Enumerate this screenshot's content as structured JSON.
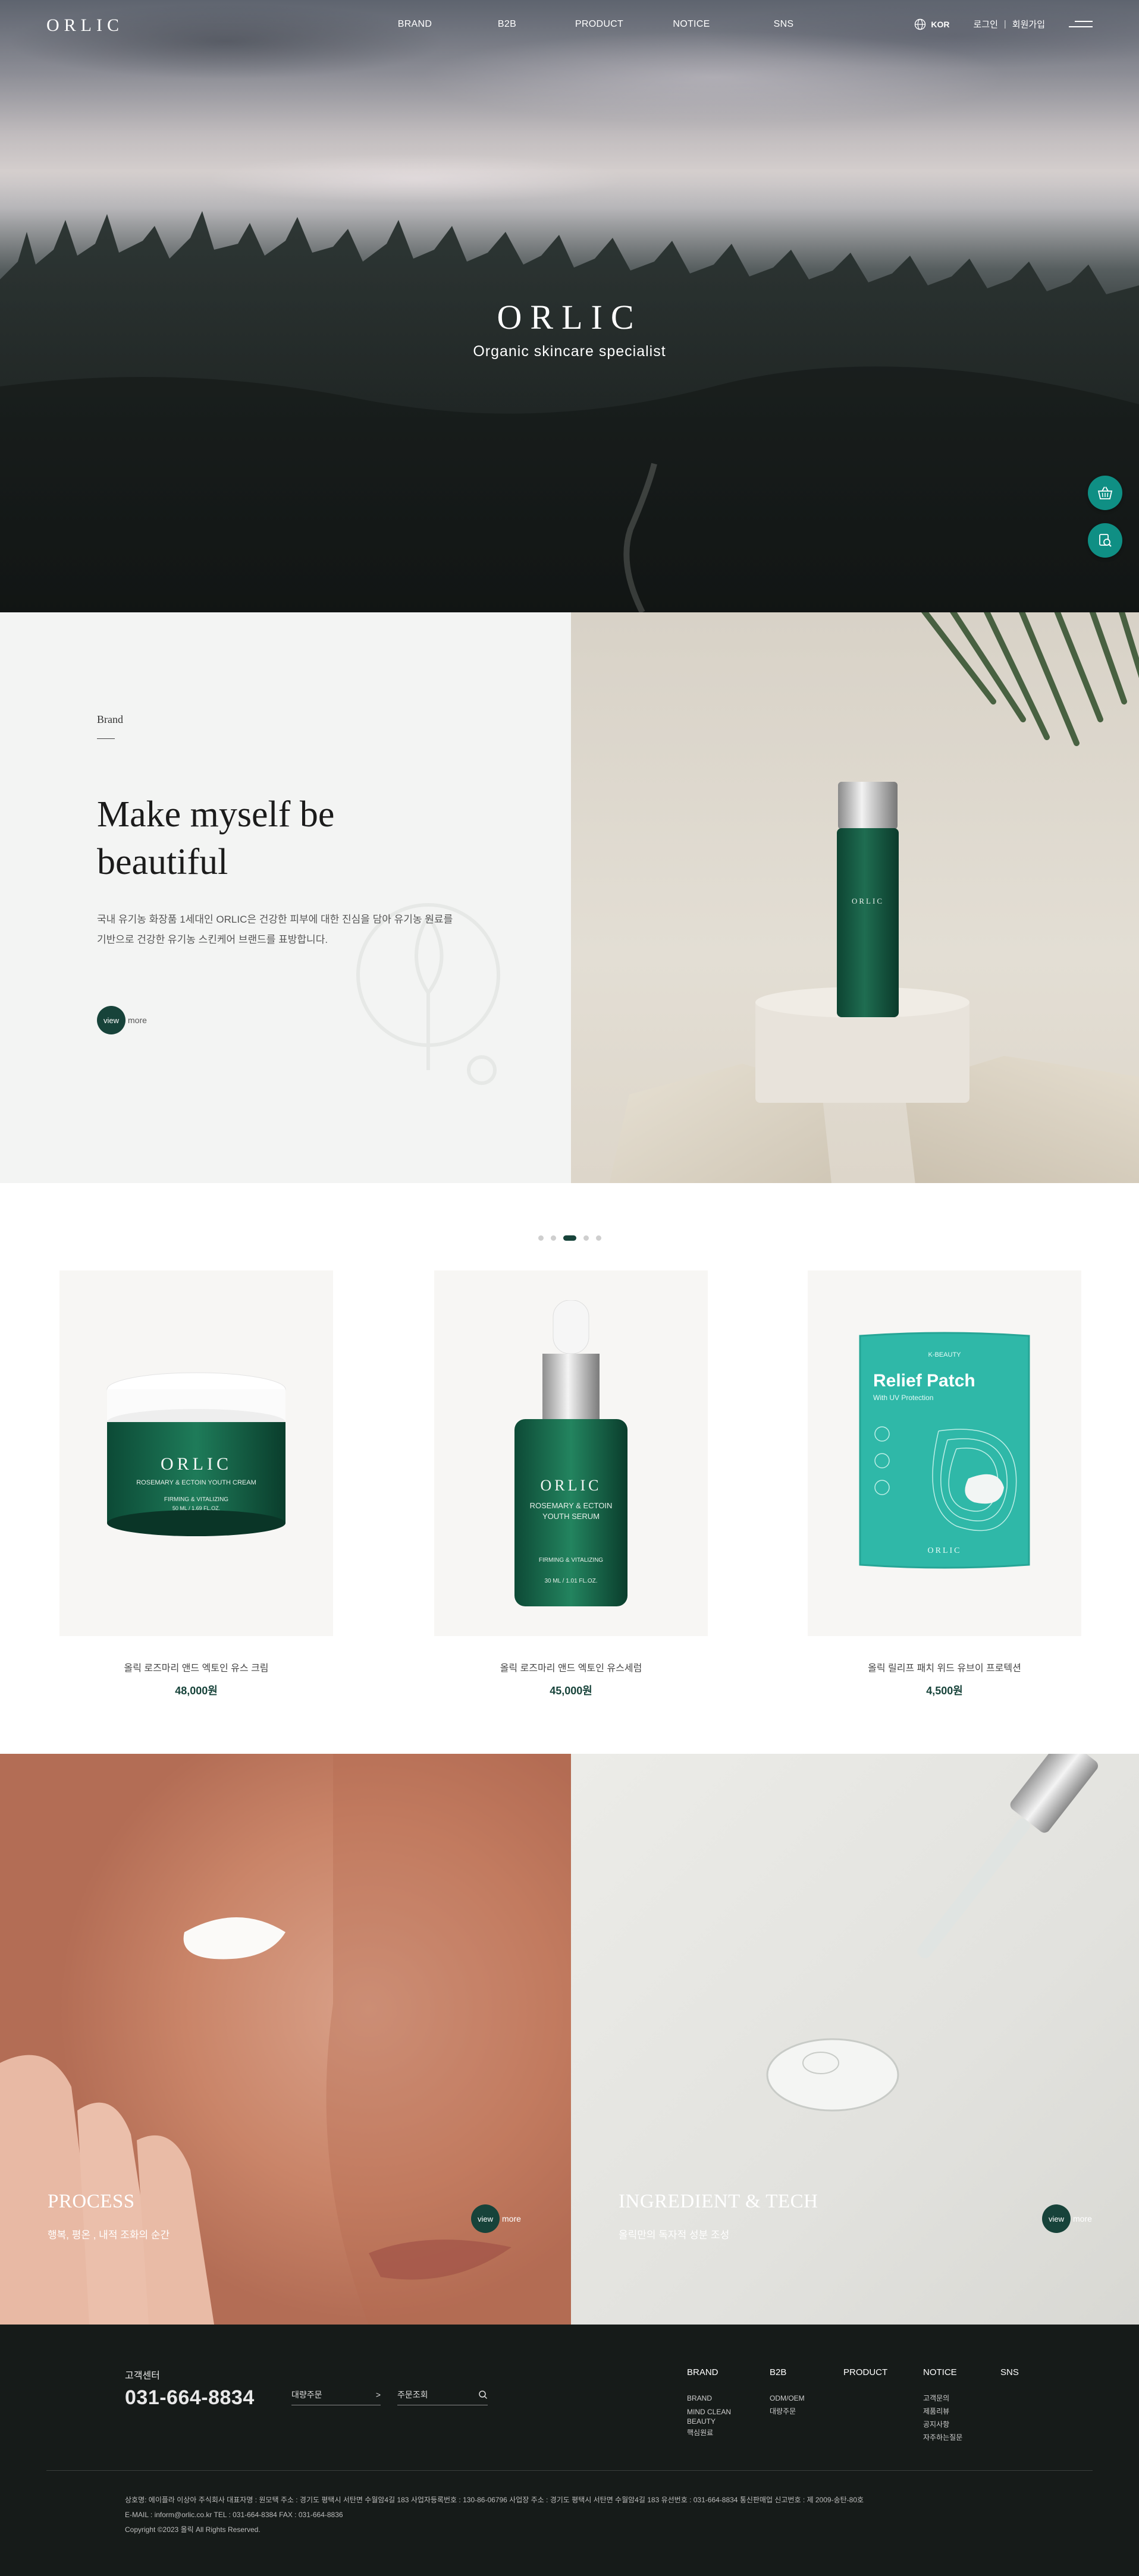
{
  "header": {
    "logo": "ORLIC",
    "nav": [
      "BRAND",
      "B2B",
      "PRODUCT",
      "NOTICE",
      "SNS"
    ],
    "lang": "KOR",
    "login": "로그인",
    "join": "회원가입"
  },
  "hero": {
    "title": "ORLIC",
    "subtitle": "Organic skincare specialist"
  },
  "quick_menu": [
    "cart-icon",
    "order-search-icon"
  ],
  "brand": {
    "label": "Brand",
    "heading_line1": "Make myself be",
    "heading_line2": "beautiful",
    "desc_line1": "국내 유기농 화장품 1세대인 ORLIC은 건강한 피부에 대한 진심을 담아 유기농 원료를",
    "desc_line2": "기반으로 건강한 유기농 스킨케어 브랜드를 표방합니다.",
    "view": "view",
    "more": "more"
  },
  "products": {
    "active_slide": 3,
    "slide_count": 5,
    "items": [
      {
        "name": "올릭 로즈마리 앤드 엑토인 유스 크림",
        "price": "48,000원"
      },
      {
        "name": "올릭 로즈마리 앤드 엑토인 유스세럼",
        "price": "45,000원"
      },
      {
        "name": "올릭 릴리프 패치 위드 유브이 프로텍션",
        "price": "4,500원"
      }
    ],
    "package_text": {
      "cream_brand": "ORLIC",
      "cream_line": "ROSEMARY & ECTOIN YOUTH CREAM",
      "cream_sub": "FIRMING & VITALIZING",
      "cream_vol": "50 ML / 1.69 FL.OZ.",
      "serum_brand": "ORLIC",
      "serum_line1": "ROSEMARY & ECTOIN",
      "serum_line2": "YOUTH SERUM",
      "serum_sub": "FIRMING & VITALIZING",
      "serum_vol": "30 ML / 1.01 FL.OZ.",
      "patch_top": "K-BEAUTY",
      "patch_title": "Relief Patch",
      "patch_sub": "With UV Protection",
      "patch_brand": "ORLIC"
    }
  },
  "features": [
    {
      "title": "PROCESS",
      "subtitle": "행복, 평온 , 내적 조화의 순간",
      "view": "view",
      "more": "more"
    },
    {
      "title": "INGREDIENT & TECH",
      "subtitle": "올릭만의 독자적 성분 조성",
      "view": "view",
      "more": "more"
    }
  ],
  "footer": {
    "cs_label": "고객센터",
    "phone": "031-664-8834",
    "bulk_order": "대량주문",
    "bulk_arrow": ">",
    "order_lookup": "주문조회",
    "menus": [
      {
        "title": "BRAND",
        "items": [
          "BRAND",
          "MIND CLEAN BEAUTY",
          "핵심원료"
        ]
      },
      {
        "title": "B2B",
        "items": [
          "ODM/OEM",
          "대량주문"
        ]
      },
      {
        "title": "PRODUCT",
        "items": []
      },
      {
        "title": "NOTICE",
        "items": [
          "고객문의",
          "제품리뷰",
          "공지사항",
          "자주하는질문"
        ]
      },
      {
        "title": "SNS",
        "items": []
      }
    ],
    "info_line1": "상호명: 에이플라 이상아 주식회사    대표자명 : 원모택    주소 : 경기도 평택시 서탄면 수월암4길 183    사업자등록번호 : 130-86-06796    사업장 주소 : 경기도 평택시 서탄면 수월암4길 183    유선번호 : 031-664-8834    통신판매업 신고번호 : 제 2009-송탄-80호",
    "info_line2": "E-MAIL : inform@orlic.co.kr    TEL : 031-664-8384    FAX : 031-664-8836",
    "copyright": "Copyright ©2023 올릭 All Rights Reserved."
  },
  "colors": {
    "brand_green": "#17433a",
    "quick_teal": "#0f8f84",
    "footer_bg": "#161b19"
  }
}
